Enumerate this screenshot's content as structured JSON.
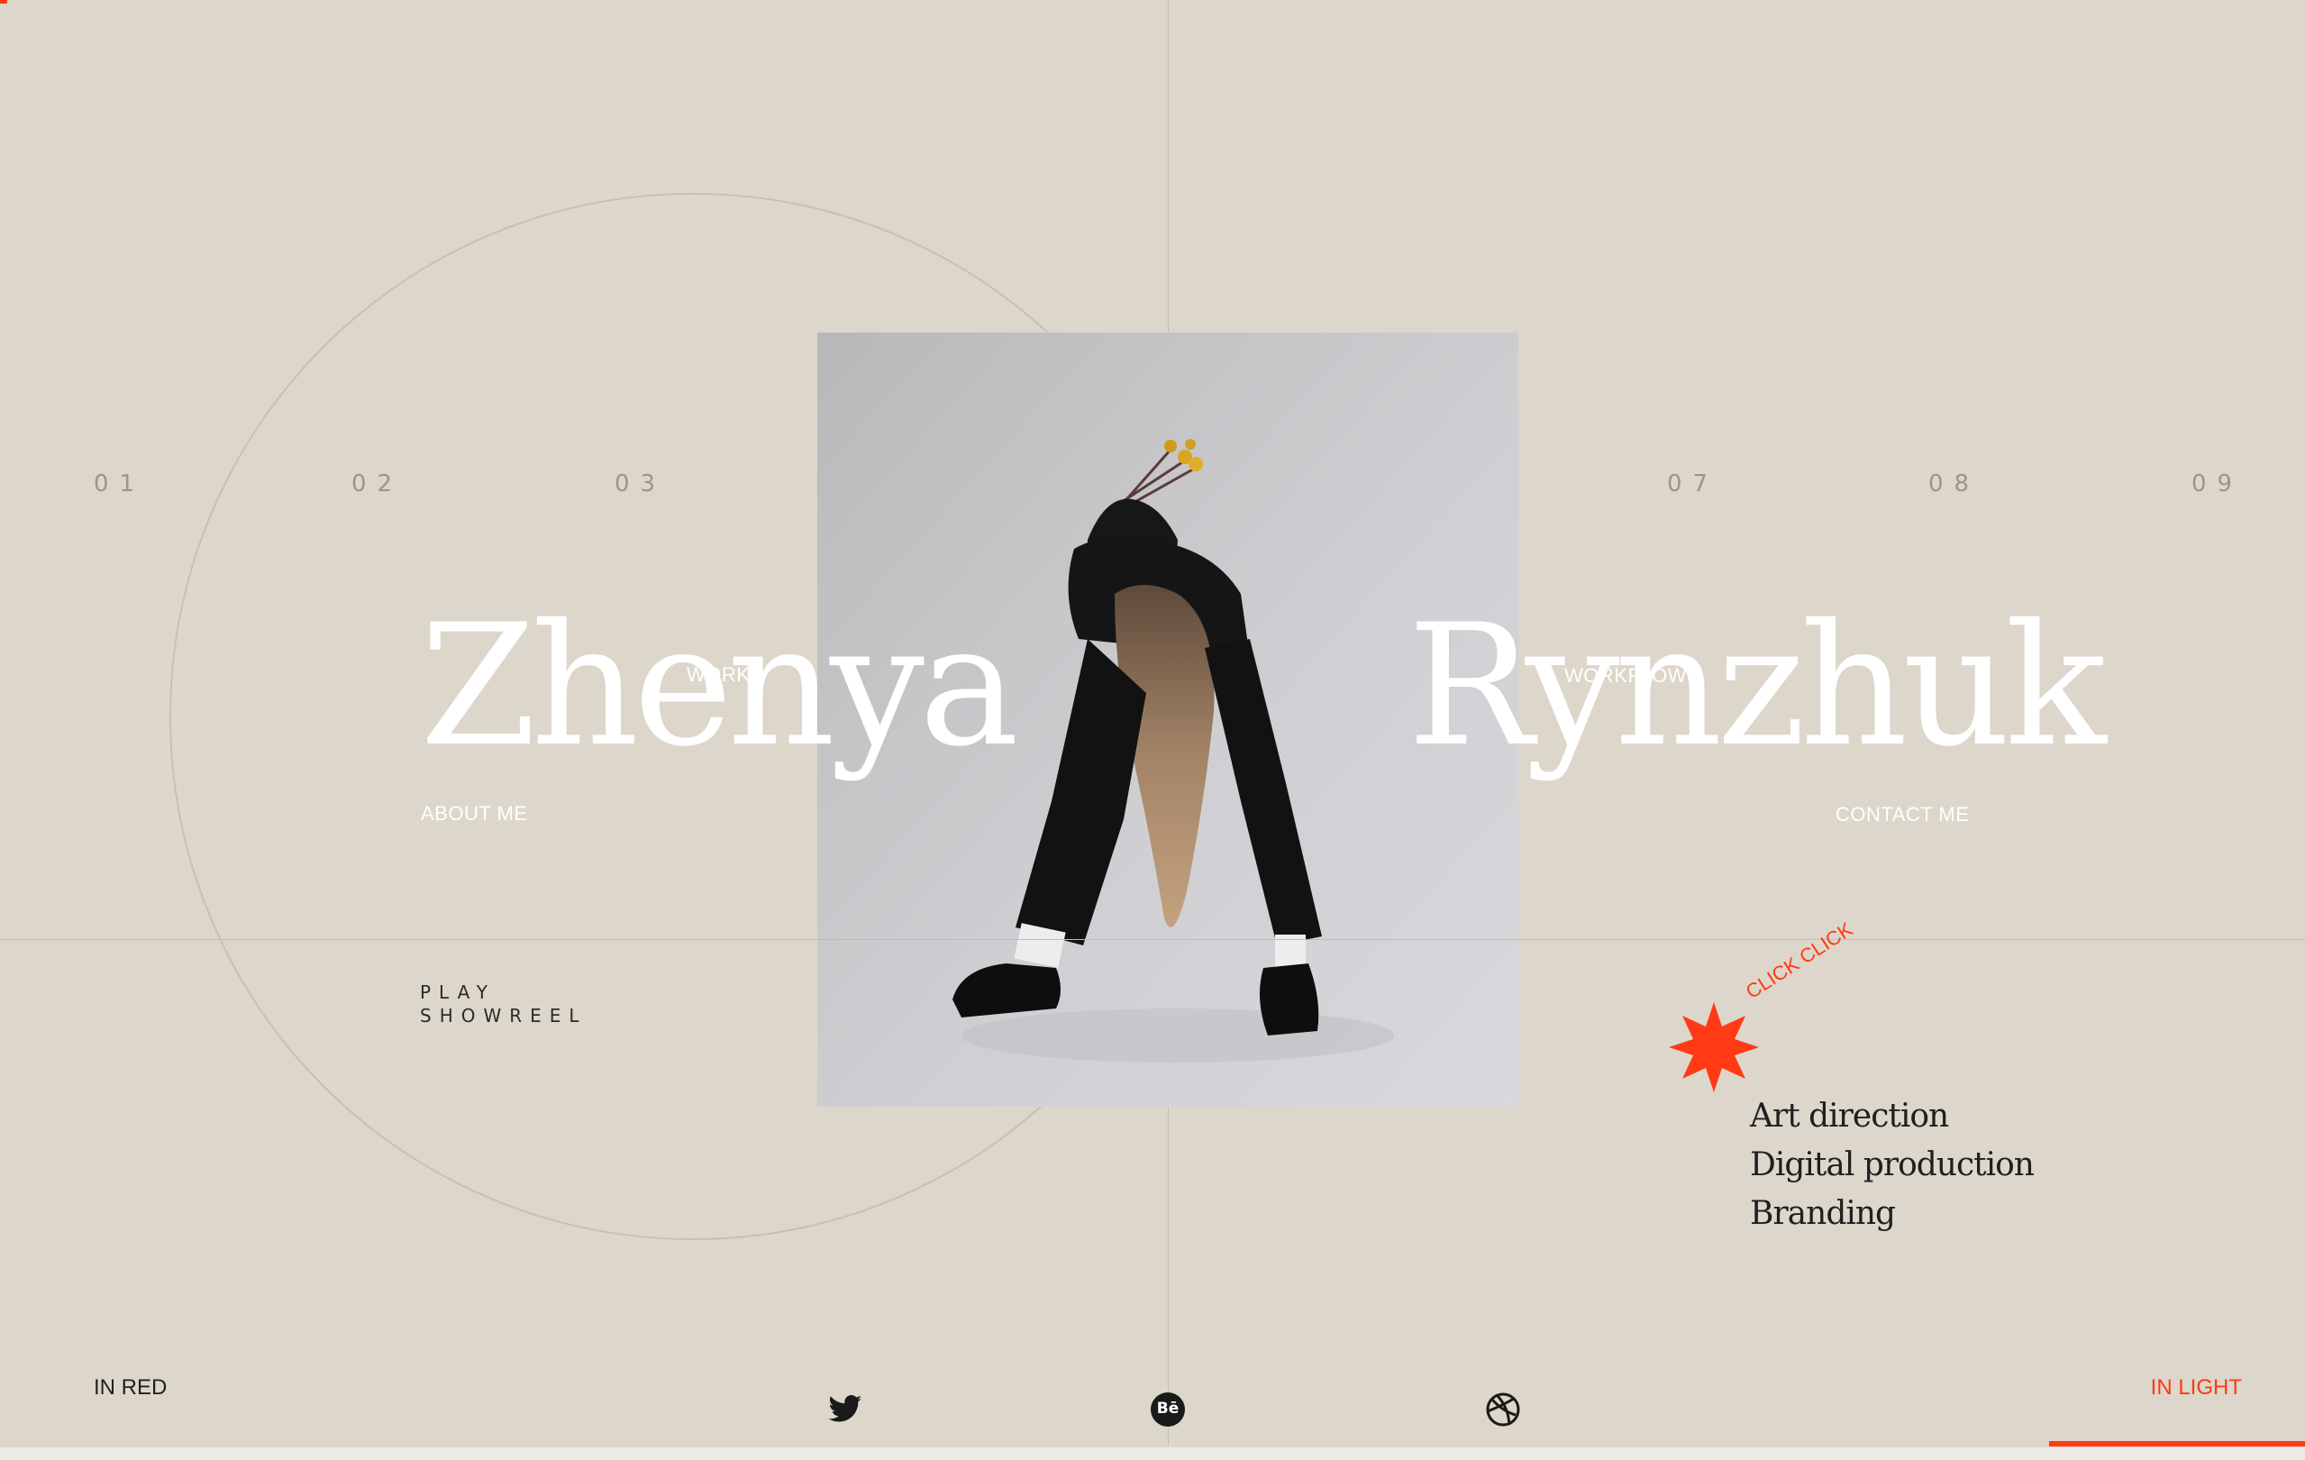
{
  "nav_numbers": [
    "01",
    "02",
    "03",
    "07",
    "08",
    "09"
  ],
  "hero": {
    "first_name": "Zhenya",
    "last_name": "Rynzhuk"
  },
  "links": {
    "work": "WORK",
    "about": "ABOUT ME",
    "workflow": "WORKFLOW",
    "contact": "CONTACT ME"
  },
  "showreel": {
    "line1": "PLAY",
    "line2": "SHOWREEL"
  },
  "badge": {
    "label": "CLICK CLICK"
  },
  "services": [
    "Art direction",
    "Digital production",
    "Branding"
  ],
  "footer": {
    "left_label": "IN RED",
    "right_label": "IN LIGHT",
    "social_icons": [
      "twitter-icon",
      "behance-icon",
      "dribbble-icon"
    ],
    "behance_text": "Bē"
  },
  "colors": {
    "background": "#ddd6ca",
    "accent": "#ff3a14",
    "text_dark": "#1f1f1f",
    "hero_text": "#ffffff"
  }
}
